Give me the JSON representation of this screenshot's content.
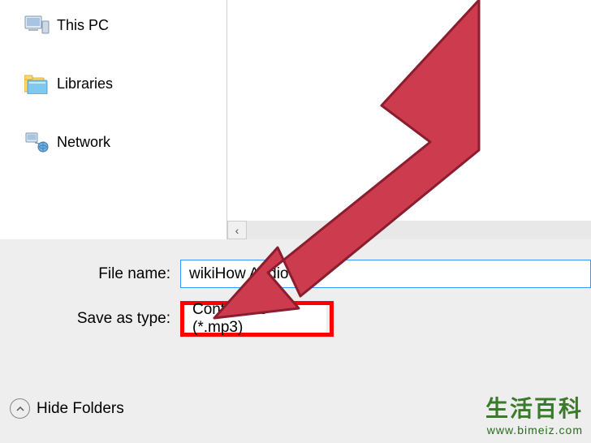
{
  "nav": {
    "items": [
      {
        "label": "This PC",
        "icon": "pc"
      },
      {
        "label": "Libraries",
        "icon": "libraries"
      },
      {
        "label": "Network",
        "icon": "network"
      }
    ]
  },
  "form": {
    "filename_label": "File name:",
    "filename_value": "wikiHow Audio",
    "saveastype_label": "Save as type:",
    "saveastype_value": "Containers (*.mp3)"
  },
  "footer": {
    "hide_folders_label": "Hide Folders"
  },
  "scroll": {
    "left_glyph": "‹"
  },
  "watermark": {
    "cn": "生活百科",
    "url": "www.bimeiz.com"
  }
}
